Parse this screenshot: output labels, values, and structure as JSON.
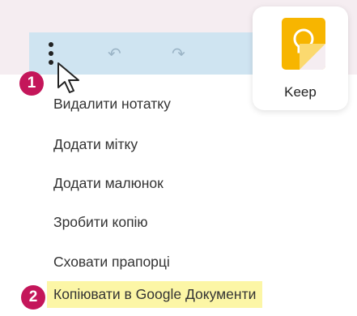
{
  "toolbar": {
    "more_icon": "vertical-ellipsis-icon",
    "undo_icon": "undo-icon",
    "undo_glyph": "↶",
    "redo_icon": "redo-icon",
    "redo_glyph": "↷"
  },
  "app": {
    "name": "Keep",
    "icon": "lightbulb-icon",
    "colors": {
      "tile": "#f7b500",
      "fold": "#fbd96f"
    }
  },
  "badges": {
    "step1": "1",
    "step2": "2"
  },
  "menu": {
    "items": [
      {
        "label": "Видалити нотатку"
      },
      {
        "label": "Додати мітку"
      },
      {
        "label": "Додати малюнок"
      },
      {
        "label": "Зробити копію"
      },
      {
        "label": "Сховати прапорці"
      },
      {
        "label": "Копіювати в Google Документи",
        "highlighted": true
      }
    ]
  },
  "colors": {
    "badge": "#c4165a",
    "highlight": "#fcf6a6",
    "toolbar": "#cfe4f1",
    "background": "#f5edf1"
  }
}
